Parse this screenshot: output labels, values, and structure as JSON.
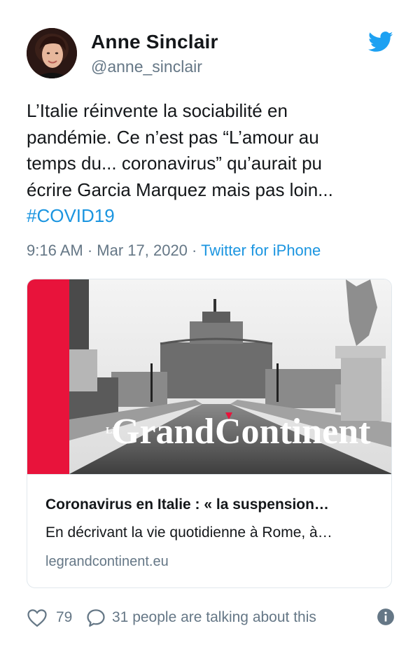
{
  "author": {
    "name": "Anne Sinclair",
    "handle": "@anne_sinclair"
  },
  "icons": {
    "platform": "twitter-bird-icon",
    "like": "heart-icon",
    "reply": "speech-bubble-icon",
    "info": "info-icon"
  },
  "colors": {
    "link": "#1b95e0",
    "secondary": "#657786",
    "brand": "#1da1f2",
    "logo_accent": "#e8133b"
  },
  "tweet": {
    "lines": [
      "L’Italie réinvente la sociabilité en",
      "pandémie. Ce n’est pas “L’amour au",
      "temps du... coronavirus” qu’aurait pu",
      "écrire Garcia Marquez mais pas loin..."
    ],
    "hashtag": "#COVID19"
  },
  "meta": {
    "time": "9:16 AM",
    "separator1": " · ",
    "date": "Mar 17, 2020",
    "separator2": " · ",
    "source": "Twitter for iPhone"
  },
  "card": {
    "logo_prefix": "LE",
    "logo_word1": "Grand",
    "logo_word2": "Continent",
    "title": "Coronavirus en Italie : « la suspension…",
    "description": "En décrivant la vie quotidienne à Rome, à…",
    "domain": "legrandcontinent.eu"
  },
  "footer": {
    "likes": "79",
    "talking": "31 people are talking about this"
  }
}
